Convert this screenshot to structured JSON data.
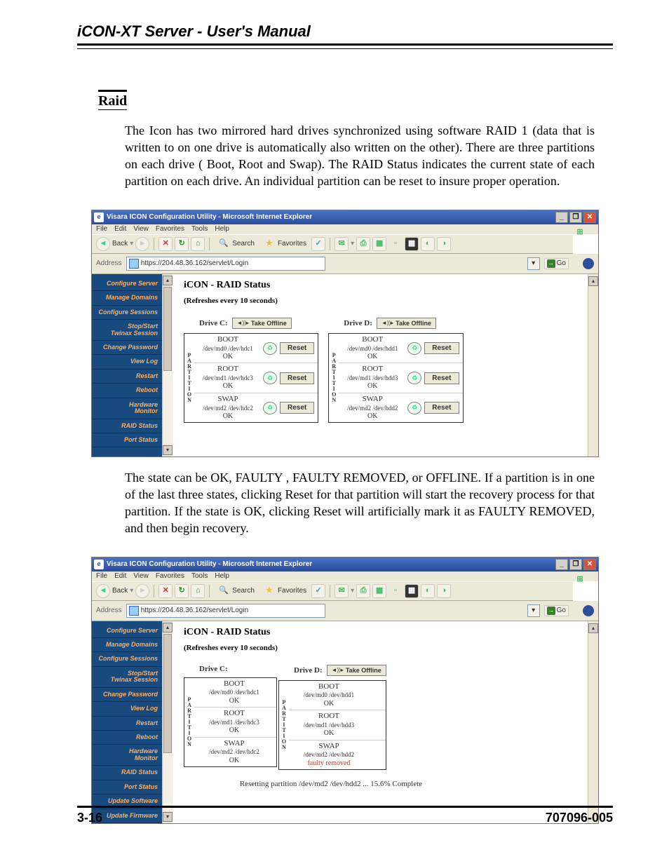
{
  "doc": {
    "header": "iCON-XT Server - User's Manual",
    "section": "Raid",
    "intro": "The Icon has two mirrored hard drives synchronized using software RAID 1  (data that is written to on one drive is automatically also written on the other). There are three partitions on each drive ( Boot, Root and Swap).  The RAID Status indicates the current state of each partition on each drive. An individual partition can be reset to insure proper operation.",
    "after": "The state can be OK, FAULTY , FAULTY REMOVED, or OFFLINE.  If a partition is in one of the last three states, clicking Reset for that partition will start the recovery process for that partition. If the state is OK, clicking Reset will artificially mark it as FAULTY REMOVED, and then begin recovery.",
    "page_num": "3-16",
    "doc_num": "707096-005"
  },
  "window": {
    "title": "Visara ICON Configuration Utility - Microsoft Internet Explorer",
    "menubar": [
      "File",
      "Edit",
      "View",
      "Favorites",
      "Tools",
      "Help"
    ],
    "toolbar": {
      "back": "Back",
      "search": "Search",
      "favorites": "Favorites"
    },
    "address_label": "Address",
    "address_url": "https://204.48.36.162/servlet/Login",
    "go_label": "Go"
  },
  "nav_items_a": [
    "Configure Server",
    "Manage Domains",
    "Configure Sessions",
    "Stop/Start\nTwinax Session",
    "Change Password",
    "View Log",
    "Restart",
    "Reboot",
    "Hardware\nMonitor",
    "RAID Status",
    "Port Status"
  ],
  "nav_items_b": [
    "Configure Server",
    "Manage Domains",
    "Configure Sessions",
    "Stop/Start\nTwinax Session",
    "Change Password",
    "View Log",
    "Restart",
    "Reboot",
    "Hardware\nMonitor",
    "RAID Status",
    "Port Status",
    "Update Software",
    "Update Firmware"
  ],
  "raid": {
    "title": "iCON - RAID Status",
    "subtitle": "(Refreshes every 10 seconds)",
    "take_offline": "Take Offline",
    "reset": "Reset",
    "vlabel": "PARTITION",
    "drive_c": "Drive C:",
    "drive_d": "Drive D:"
  },
  "scr1": {
    "driveC": {
      "show_offline_btn": true,
      "parts": [
        {
          "name": "BOOT",
          "dev": "/dev/md0 /dev/hdc1",
          "state": "OK",
          "reset": true
        },
        {
          "name": "ROOT",
          "dev": "/dev/md1 /dev/hdc3",
          "state": "OK",
          "reset": true
        },
        {
          "name": "SWAP",
          "dev": "/dev/md2 /dev/hdc2",
          "state": "OK",
          "reset": true
        }
      ]
    },
    "driveD": {
      "show_offline_btn": true,
      "parts": [
        {
          "name": "BOOT",
          "dev": "/dev/md0 /dev/hdd1",
          "state": "OK",
          "reset": true
        },
        {
          "name": "ROOT",
          "dev": "/dev/md1 /dev/hdd3",
          "state": "OK",
          "reset": true
        },
        {
          "name": "SWAP",
          "dev": "/dev/md2 /dev/hdd2",
          "state": "OK",
          "reset": true
        }
      ]
    }
  },
  "scr2": {
    "driveC": {
      "show_offline_btn": false,
      "parts": [
        {
          "name": "BOOT",
          "dev": "/dev/md0 /dev/hdc1",
          "state": "OK",
          "reset": false
        },
        {
          "name": "ROOT",
          "dev": "/dev/md1 /dev/hdc3",
          "state": "OK",
          "reset": false
        },
        {
          "name": "SWAP",
          "dev": "/dev/md2 /dev/hdc2",
          "state": "OK",
          "reset": false
        }
      ]
    },
    "driveD": {
      "show_offline_btn": true,
      "parts": [
        {
          "name": "BOOT",
          "dev": "/dev/md0 /dev/hdd1",
          "state": "OK",
          "reset": false
        },
        {
          "name": "ROOT",
          "dev": "/dev/md1 /dev/hdd3",
          "state": "OK",
          "reset": false
        },
        {
          "name": "SWAP",
          "dev": "/dev/md2 /dev/hdd2",
          "state": "faulty removed",
          "fault": true,
          "reset": false
        }
      ]
    },
    "progress": "Resetting partition /dev/md2 /dev/hdd2 ... 15.6% Complete"
  }
}
